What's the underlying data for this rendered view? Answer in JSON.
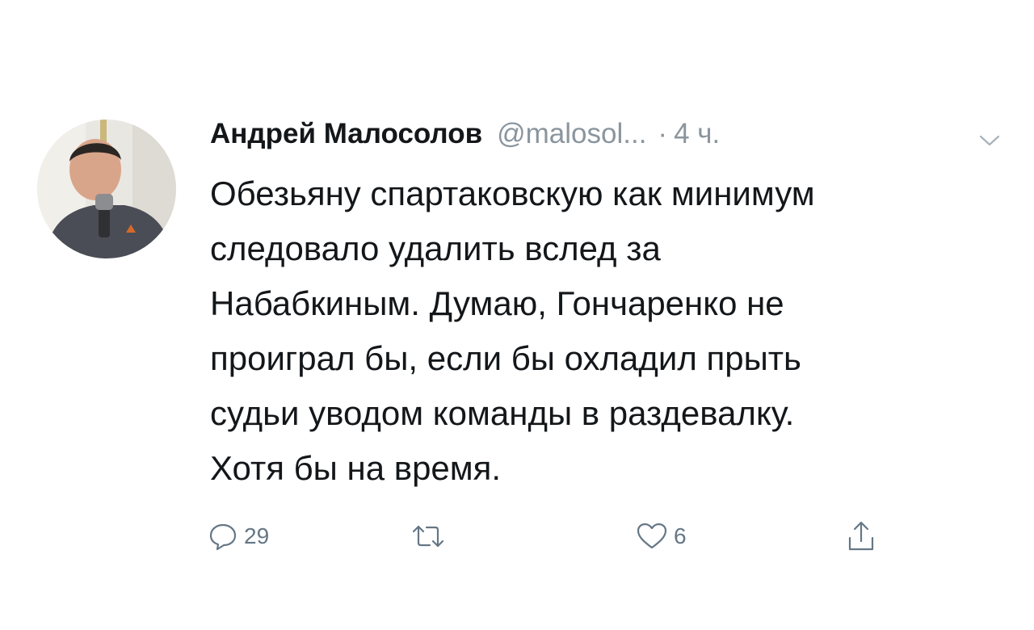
{
  "tweet": {
    "author_name": "Андрей Малосолов",
    "handle": "@malosol...",
    "separator": "·",
    "time": "4 ч.",
    "lines": [
      "Обезьяну спартаковскую как минимум",
      "следовало удалить вслед за",
      "Набабкиным. Думаю, Гончаренко не",
      "проиграл бы, если бы охладил прыть",
      "судьи уводом команды в раздевалку.",
      "Хотя бы на время."
    ],
    "actions": {
      "reply": {
        "icon": "reply-icon",
        "count": "29"
      },
      "retweet": {
        "icon": "retweet-icon",
        "count": ""
      },
      "like": {
        "icon": "heart-icon",
        "count": "6"
      },
      "share": {
        "icon": "share-icon"
      }
    },
    "avatar_icon": "avatar",
    "menu_icon": "chevron-down-icon"
  },
  "colors": {
    "text": "#14171a",
    "secondary": "#8a959e",
    "icon": "#657786",
    "background": "#ffffff"
  }
}
